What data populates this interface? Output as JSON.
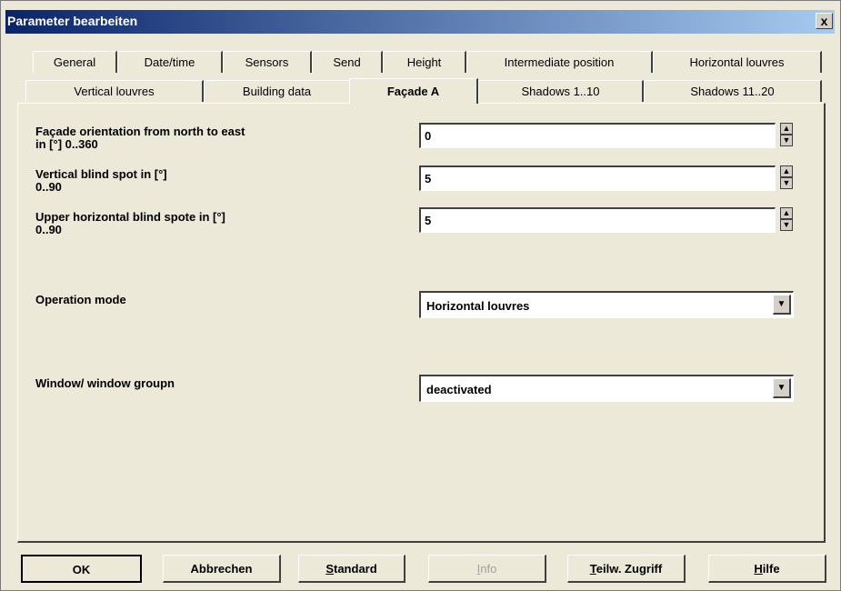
{
  "window": {
    "title": "Parameter bearbeiten",
    "close_label": "x"
  },
  "tabs_row1": [
    "General",
    "Date/time",
    "Sensors",
    "Send",
    "Height",
    "Intermediate position",
    "Horizontal louvres"
  ],
  "tabs_row2": [
    "Vertical louvres",
    "Building data",
    "Façade A",
    "Shadows 1..10",
    "Shadows 11..20"
  ],
  "active_tab": "Façade A",
  "fields": {
    "facade_orientation": {
      "label1": "Façade orientation from north to east",
      "label2": "in [°]  0..360",
      "value": "0"
    },
    "vertical_blind_spot": {
      "label1": "Vertical blind spot in [°]",
      "label2": "0..90",
      "value": "5"
    },
    "upper_horizontal_blind_spot": {
      "label1": "Upper horizontal blind spote in [°]",
      "label2": "0..90",
      "value": "5"
    },
    "operation_mode": {
      "label": "Operation mode",
      "value": "Horizontal louvres"
    },
    "window_group": {
      "label": "Window/ window groupn",
      "value": "deactivated"
    }
  },
  "buttons": {
    "ok": "OK",
    "cancel": "Abbrechen",
    "standard_prefix": "S",
    "standard_rest": "tandard",
    "info_prefix": "I",
    "info_rest": "nfo",
    "partial_prefix": "T",
    "partial_rest": "eilw. Zugriff",
    "help_prefix": "H",
    "help_rest": "ilfe"
  },
  "icons": {
    "spin_up": "▲",
    "spin_down": "▼",
    "dropdown": "▼"
  }
}
